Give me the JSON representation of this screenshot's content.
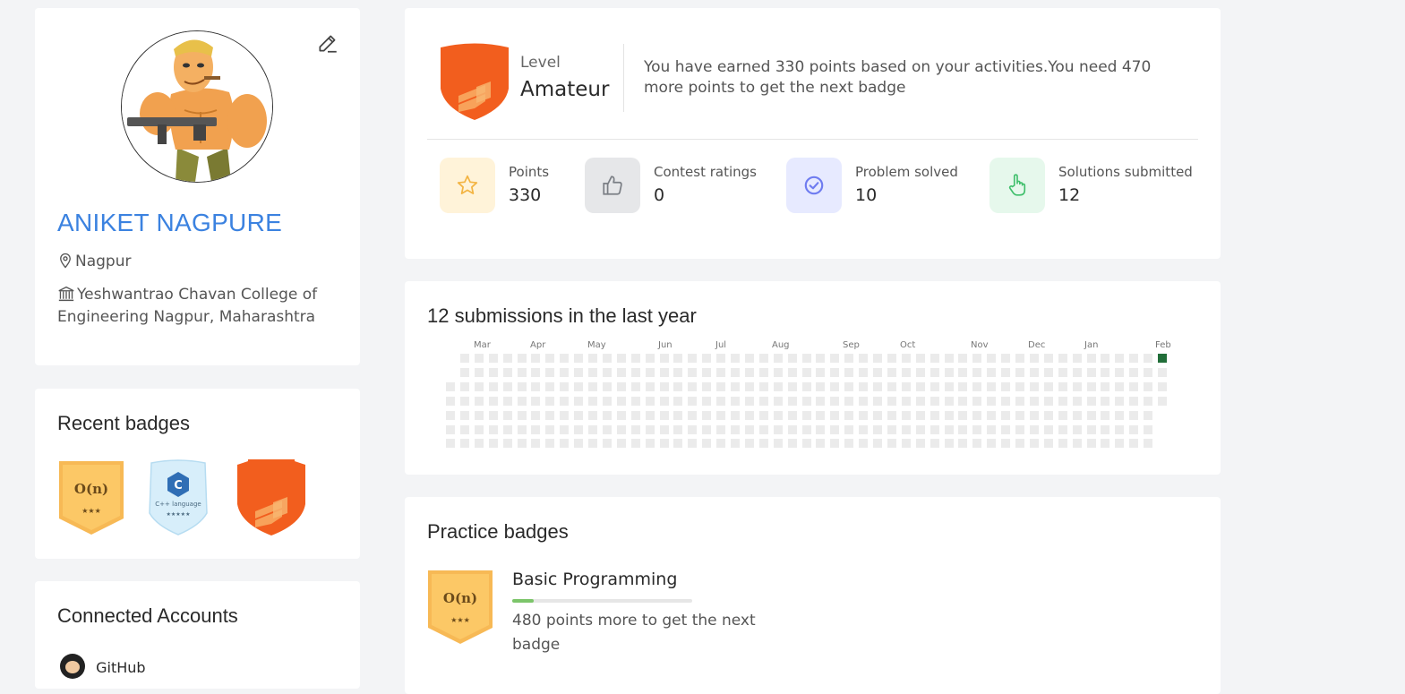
{
  "profile": {
    "name": "ANIKET NAGPURE",
    "location": "Nagpur",
    "college": "Yeshwantrao Chavan College of Engineering Nagpur, Maharashtra"
  },
  "recent_badges": {
    "title": "Recent badges",
    "items": [
      {
        "icon": "on-badge-icon",
        "text": "O(n)",
        "stars": "★★★"
      },
      {
        "icon": "c-language-badge-icon",
        "text": "C++ language",
        "stars": "★★★★★"
      },
      {
        "icon": "level-shield-icon"
      }
    ]
  },
  "connected_accounts": {
    "title": "Connected Accounts",
    "github_label": "GitHub"
  },
  "level": {
    "label": "Level",
    "value": "Amateur",
    "message": "You have earned 330 points based on your activities.You need 470 more points to get the next badge"
  },
  "stats": [
    {
      "label": "Points",
      "value": "330",
      "icon": "star-icon",
      "bg": "#fff3d9",
      "color": "#f3b443"
    },
    {
      "label": "Contest ratings",
      "value": "0",
      "icon": "thumbs-up-icon",
      "bg": "#e6e7e9",
      "color": "#7b7f85"
    },
    {
      "label": "Problem solved",
      "value": "10",
      "icon": "check-circle-icon",
      "bg": "#e7eaff",
      "color": "#6f7cf0"
    },
    {
      "label": "Solutions submitted",
      "value": "12",
      "icon": "pointer-hand-icon",
      "bg": "#e6f8ec",
      "color": "#3fbf6b"
    }
  ],
  "heatmap": {
    "title": "12 submissions in the last year",
    "months": [
      "Mar",
      "Apr",
      "May",
      "Jun",
      "Jul",
      "Aug",
      "Sep",
      "Oct",
      "Nov",
      "Dec",
      "Jan",
      "Feb"
    ],
    "weeks": 51,
    "active_cells": [
      {
        "week": 50,
        "day": 0,
        "level": 3
      }
    ],
    "empty_color": "#ebebeb",
    "active_color": "#216e39"
  },
  "practice_badges": {
    "title": "Practice badges",
    "items": [
      {
        "name": "Basic Programming",
        "progress": 0.12,
        "hint": "480 points more to get the next badge",
        "badge_text": "O(n)",
        "stars": "★★★"
      }
    ]
  },
  "colors": {
    "accent": "#3b82e0",
    "shield_orange": "#f25e1e",
    "gold_badge": "#fbc35c"
  }
}
